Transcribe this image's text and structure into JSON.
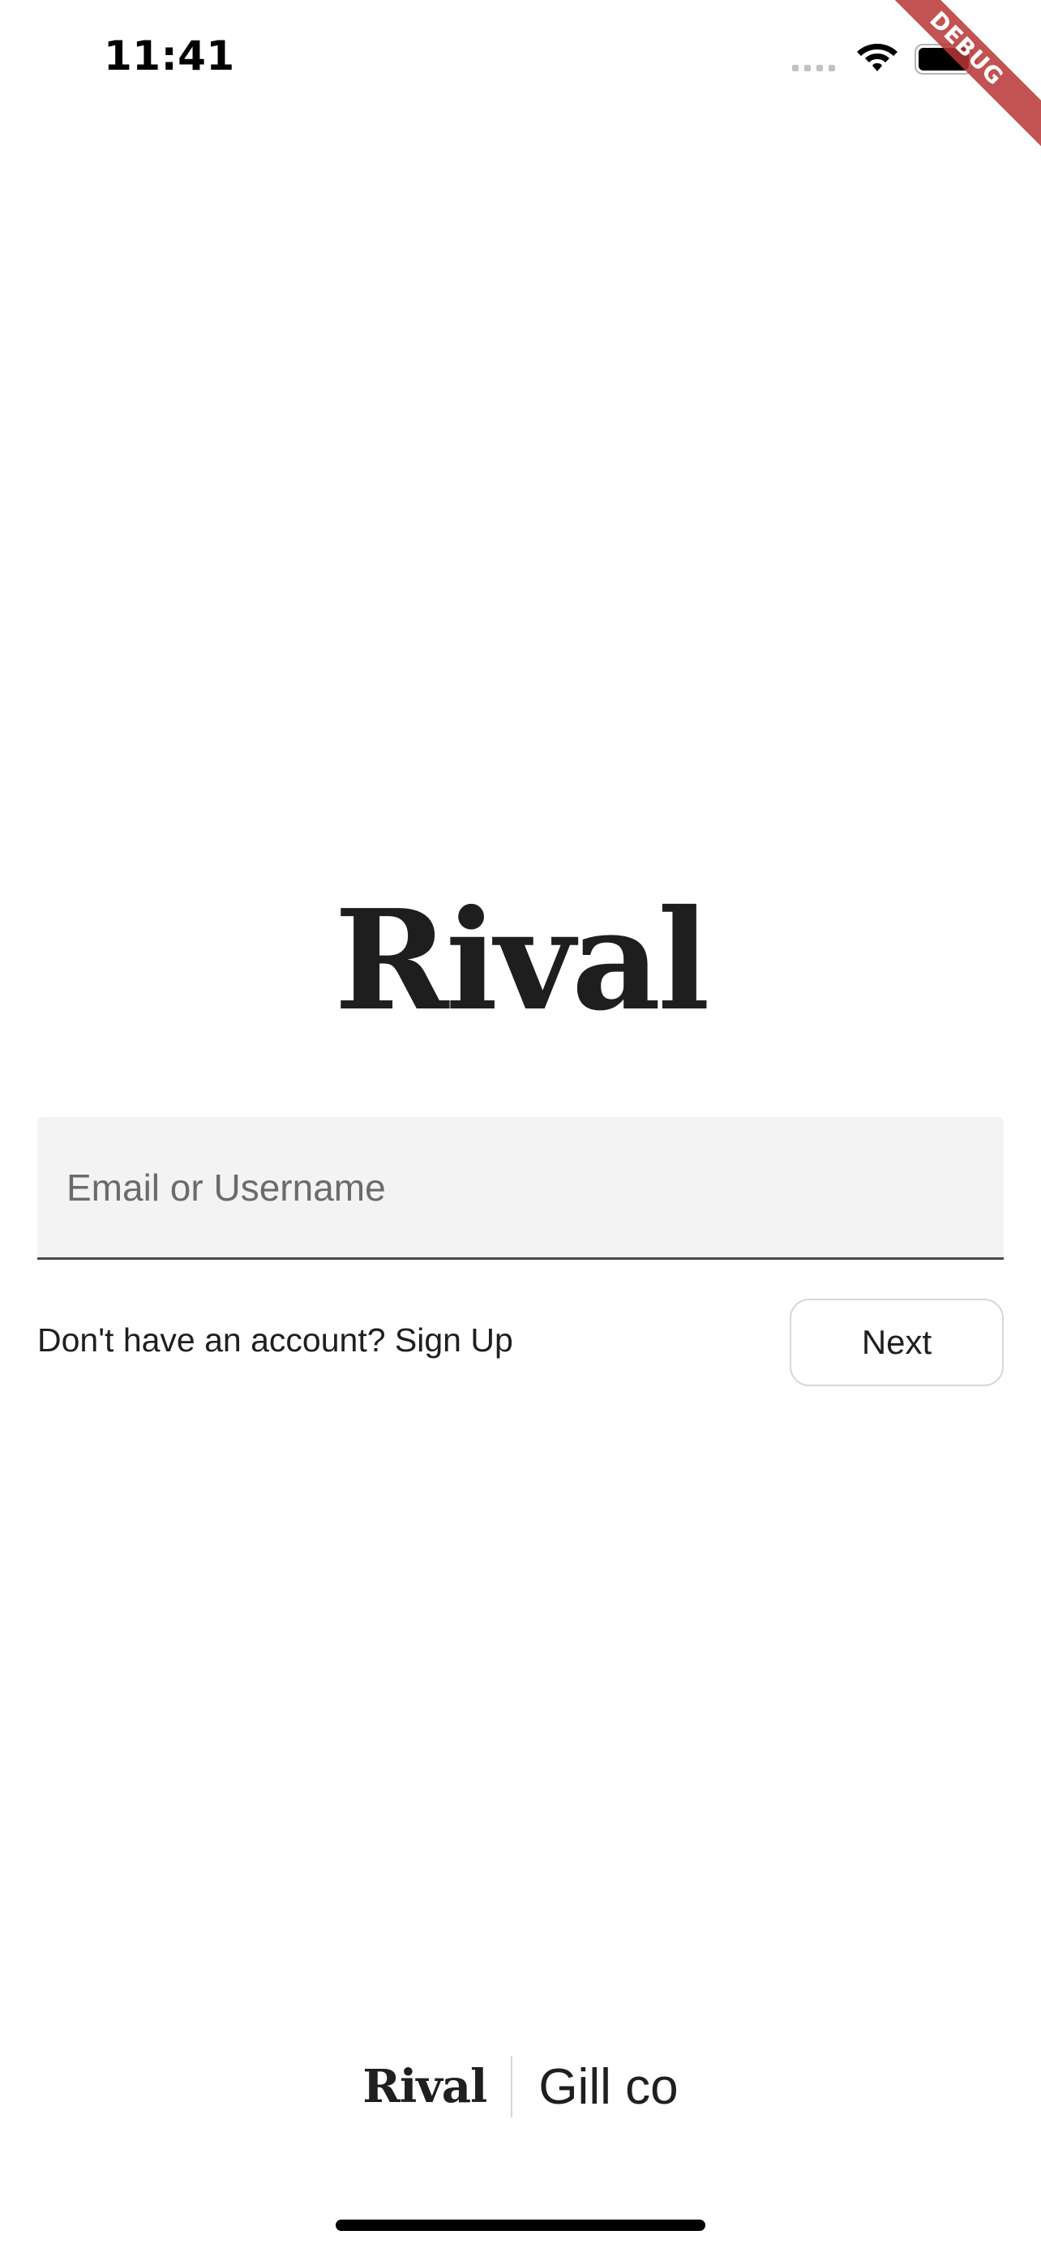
{
  "status_bar": {
    "time": "11:41",
    "icons": [
      "cellular-signal-icon",
      "wifi-icon",
      "battery-icon"
    ]
  },
  "debug_banner": {
    "label": "DEBUG",
    "color": "#b83434"
  },
  "logo": {
    "text": "Rival"
  },
  "login_form": {
    "email_placeholder": "Email or Username",
    "email_value": "",
    "signup_prompt": "Don't have an account? Sign Up",
    "next_label": "Next"
  },
  "footer": {
    "brand": "Rival",
    "partner": "Gill co"
  },
  "colors": {
    "background": "#ffffff",
    "text": "#1f1f1f",
    "input_fill": "#f3f3f3",
    "input_underline": "#4a4a4a",
    "button_border": "#d8d8d8"
  }
}
